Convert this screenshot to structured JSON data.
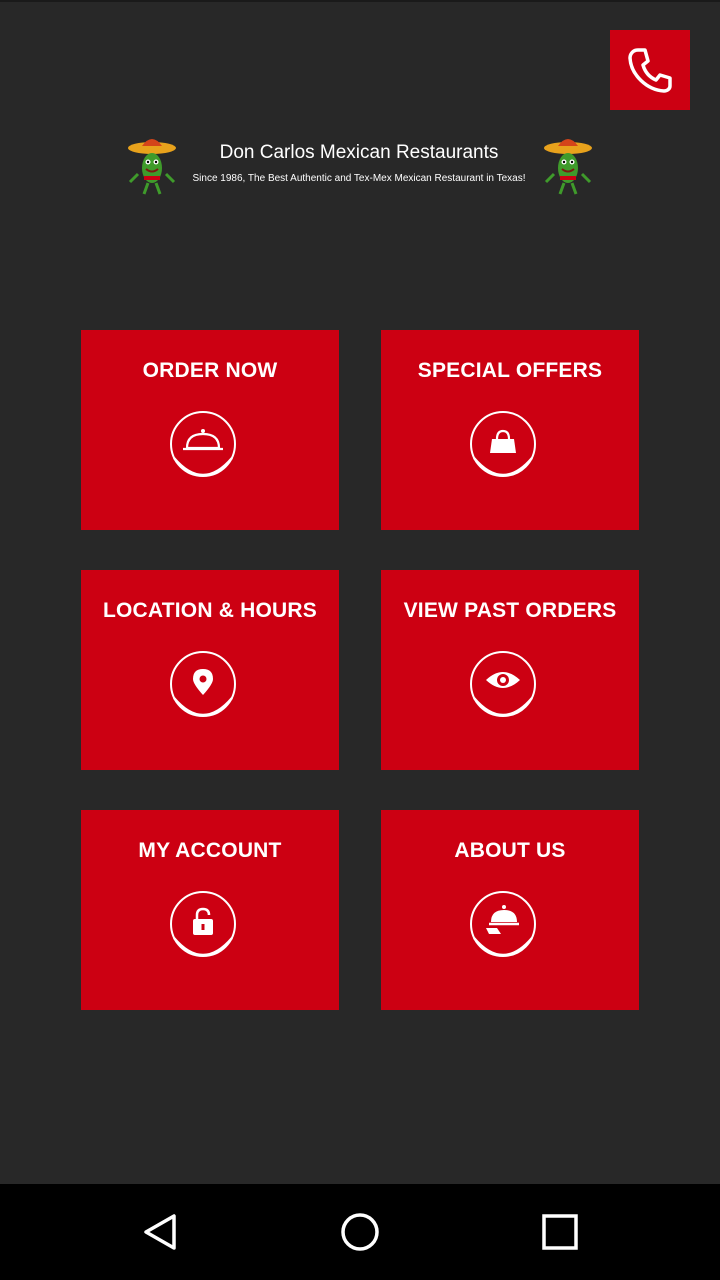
{
  "header": {
    "title": "Don Carlos Mexican Restaurants",
    "subtitle": "Since 1986, The Best Authentic and Tex-Mex Mexican Restaurant in Texas!"
  },
  "tiles": [
    {
      "label": "ORDER NOW",
      "icon": "cloche-icon"
    },
    {
      "label": "SPECIAL OFFERS",
      "icon": "shopping-bag-icon"
    },
    {
      "label": "LOCATION & HOURS",
      "icon": "location-pin-icon"
    },
    {
      "label": "VIEW PAST ORDERS",
      "icon": "eye-icon"
    },
    {
      "label": "MY ACCOUNT",
      "icon": "lock-icon"
    },
    {
      "label": "ABOUT US",
      "icon": "waiter-cloche-icon"
    }
  ],
  "icons": {
    "call": "phone-icon",
    "nav": [
      "back-icon",
      "home-icon",
      "recents-icon"
    ]
  },
  "colors": {
    "background": "#282828",
    "accent": "#cc0012",
    "text": "#ffffff",
    "navbar": "#000000"
  }
}
